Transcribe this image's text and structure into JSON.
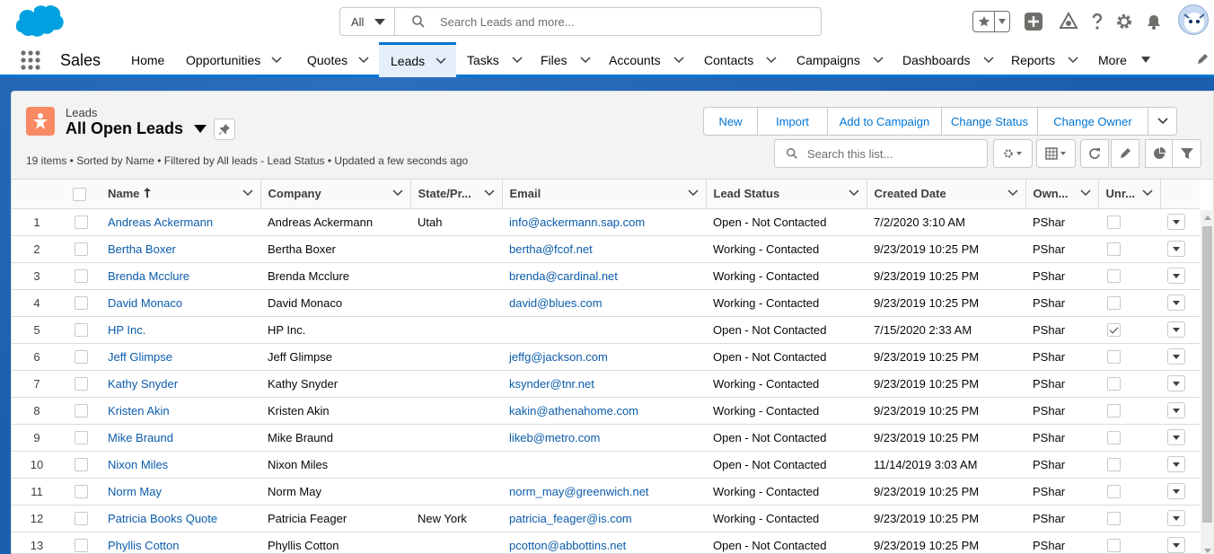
{
  "search": {
    "scope": "All",
    "placeholder": "Search Leads and more..."
  },
  "app": {
    "name": "Sales"
  },
  "nav": [
    {
      "label": "Home",
      "has_menu": false
    },
    {
      "label": "Opportunities",
      "has_menu": true
    },
    {
      "label": "Quotes",
      "has_menu": true
    },
    {
      "label": "Leads",
      "has_menu": true,
      "active": true
    },
    {
      "label": "Tasks",
      "has_menu": true
    },
    {
      "label": "Files",
      "has_menu": true
    },
    {
      "label": "Accounts",
      "has_menu": true
    },
    {
      "label": "Contacts",
      "has_menu": true
    },
    {
      "label": "Campaigns",
      "has_menu": true
    },
    {
      "label": "Dashboards",
      "has_menu": true
    },
    {
      "label": "Reports",
      "has_menu": true
    },
    {
      "label": "More",
      "has_menu": true
    }
  ],
  "list_header": {
    "object_label": "Leads",
    "list_view": "All Open Leads",
    "meta": "19 items • Sorted by Name • Filtered by All leads - Lead Status • Updated a few seconds ago",
    "search_placeholder": "Search this list..."
  },
  "actions": {
    "new": "New",
    "import": "Import",
    "add_to_campaign": "Add to Campaign",
    "change_status": "Change Status",
    "change_owner": "Change Owner"
  },
  "columns": {
    "name": "Name",
    "company": "Company",
    "state": "State/Pr...",
    "email": "Email",
    "lead_status": "Lead Status",
    "created_date": "Created Date",
    "owner": "Own...",
    "unread": "Unr..."
  },
  "rows": [
    {
      "n": "1",
      "name": "Andreas Ackermann",
      "company": "Andreas Ackermann",
      "state": "Utah",
      "email": "info@ackermann.sap.com",
      "status": "Open - Not Contacted",
      "created": "7/2/2020 3:10 AM",
      "owner": "PShar",
      "unread": false
    },
    {
      "n": "2",
      "name": "Bertha Boxer",
      "company": "Bertha Boxer",
      "state": "",
      "email": "bertha@fcof.net",
      "status": "Working - Contacted",
      "created": "9/23/2019 10:25 PM",
      "owner": "PShar",
      "unread": false
    },
    {
      "n": "3",
      "name": "Brenda Mcclure",
      "company": "Brenda Mcclure",
      "state": "",
      "email": "brenda@cardinal.net",
      "status": "Working - Contacted",
      "created": "9/23/2019 10:25 PM",
      "owner": "PShar",
      "unread": false
    },
    {
      "n": "4",
      "name": "David Monaco",
      "company": "David Monaco",
      "state": "",
      "email": "david@blues.com",
      "status": "Working - Contacted",
      "created": "9/23/2019 10:25 PM",
      "owner": "PShar",
      "unread": false
    },
    {
      "n": "5",
      "name": "HP Inc.",
      "company": "HP Inc.",
      "state": "",
      "email": "",
      "status": "Open - Not Contacted",
      "created": "7/15/2020 2:33 AM",
      "owner": "PShar",
      "unread": true
    },
    {
      "n": "6",
      "name": "Jeff Glimpse",
      "company": "Jeff Glimpse",
      "state": "",
      "email": "jeffg@jackson.com",
      "status": "Open - Not Contacted",
      "created": "9/23/2019 10:25 PM",
      "owner": "PShar",
      "unread": false
    },
    {
      "n": "7",
      "name": "Kathy Snyder",
      "company": "Kathy Snyder",
      "state": "",
      "email": "ksynder@tnr.net",
      "status": "Working - Contacted",
      "created": "9/23/2019 10:25 PM",
      "owner": "PShar",
      "unread": false
    },
    {
      "n": "8",
      "name": "Kristen Akin",
      "company": "Kristen Akin",
      "state": "",
      "email": "kakin@athenahome.com",
      "status": "Working - Contacted",
      "created": "9/23/2019 10:25 PM",
      "owner": "PShar",
      "unread": false
    },
    {
      "n": "9",
      "name": "Mike Braund",
      "company": "Mike Braund",
      "state": "",
      "email": "likeb@metro.com",
      "status": "Open - Not Contacted",
      "created": "9/23/2019 10:25 PM",
      "owner": "PShar",
      "unread": false
    },
    {
      "n": "10",
      "name": "Nixon Miles",
      "company": "Nixon Miles",
      "state": "",
      "email": "",
      "status": "Open - Not Contacted",
      "created": "11/14/2019 3:03 AM",
      "owner": "PShar",
      "unread": false
    },
    {
      "n": "11",
      "name": "Norm May",
      "company": "Norm May",
      "state": "",
      "email": "norm_may@greenwich.net",
      "status": "Working - Contacted",
      "created": "9/23/2019 10:25 PM",
      "owner": "PShar",
      "unread": false
    },
    {
      "n": "12",
      "name": "Patricia Books Quote",
      "company": "Patricia Feager",
      "state": "New York",
      "email": "patricia_feager@is.com",
      "status": "Working - Contacted",
      "created": "9/23/2019 10:25 PM",
      "owner": "PShar",
      "unread": false
    },
    {
      "n": "13",
      "name": "Phyllis Cotton",
      "company": "Phyllis Cotton",
      "state": "",
      "email": "pcotton@abbottins.net",
      "status": "Open - Not Contacted",
      "created": "9/23/2019 10:25 PM",
      "owner": "PShar",
      "unread": false
    }
  ]
}
